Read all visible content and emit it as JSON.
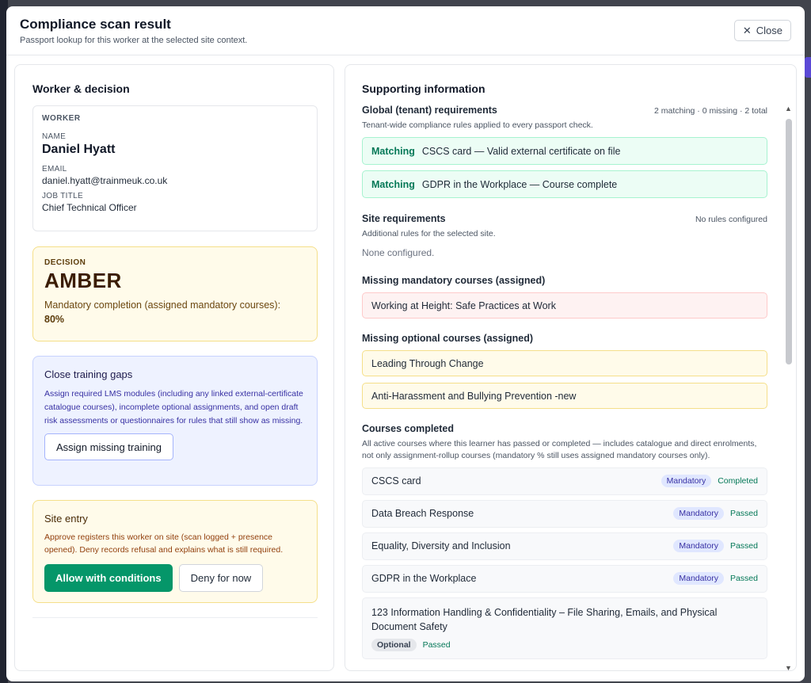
{
  "modal": {
    "title": "Compliance scan result",
    "subtitle": "Passport lookup for this worker at the selected site context.",
    "close_label": "Close"
  },
  "left": {
    "title": "Worker & decision",
    "worker": {
      "section_label": "WORKER",
      "name_label": "NAME",
      "name": "Daniel Hyatt",
      "email_label": "EMAIL",
      "email": "daniel.hyatt@trainmeuk.co.uk",
      "job_label": "JOB TITLE",
      "job": "Chief Technical Officer"
    },
    "decision": {
      "label": "DECISION",
      "value": "AMBER",
      "desc": "Mandatory completion (assigned mandatory courses):",
      "percent": "80%"
    },
    "gaps": {
      "title": "Close training gaps",
      "desc": "Assign required LMS modules (including any linked external-certificate catalogue courses), incomplete optional assignments, and open draft risk assessments or questionnaires for rules that still show as missing.",
      "button": "Assign missing training"
    },
    "site_entry": {
      "title": "Site entry",
      "desc": "Approve registers this worker on site (scan logged + presence opened). Deny records refusal and explains what is still required.",
      "allow": "Allow with conditions",
      "deny": "Deny for now"
    }
  },
  "right": {
    "title": "Supporting information",
    "global": {
      "title": "Global (tenant) requirements",
      "meta": "2 matching · 0 missing · 2 total",
      "desc": "Tenant-wide compliance rules applied to every passport check.",
      "items": [
        {
          "tag": "Matching",
          "text": "CSCS card — Valid external certificate on file"
        },
        {
          "tag": "Matching",
          "text": "GDPR in the Workplace — Course complete"
        }
      ]
    },
    "site": {
      "title": "Site requirements",
      "meta": "No rules configured",
      "desc": "Additional rules for the selected site.",
      "none": "None configured."
    },
    "missing_mandatory": {
      "title": "Missing mandatory courses (assigned)",
      "items": [
        "Working at Height: Safe Practices at Work"
      ]
    },
    "missing_optional": {
      "title": "Missing optional courses (assigned)",
      "items": [
        "Leading Through Change",
        "Anti-Harassment and Bullying Prevention -new"
      ]
    },
    "completed": {
      "title": "Courses completed",
      "desc": "All active courses where this learner has passed or completed — includes catalogue and direct enrolments, not only assignment-rollup courses (mandatory % still uses assigned mandatory courses only).",
      "items": [
        {
          "name": "CSCS card",
          "badge": "Mandatory",
          "status": "Completed"
        },
        {
          "name": "Data Breach Response",
          "badge": "Mandatory",
          "status": "Passed"
        },
        {
          "name": "Equality, Diversity and Inclusion",
          "badge": "Mandatory",
          "status": "Passed"
        },
        {
          "name": "GDPR in the Workplace",
          "badge": "Mandatory",
          "status": "Passed"
        },
        {
          "name": "123 Information Handling & Confidentiality – File Sharing, Emails, and Physical Document Safety",
          "badge": "Optional",
          "status": "Passed"
        }
      ]
    }
  }
}
